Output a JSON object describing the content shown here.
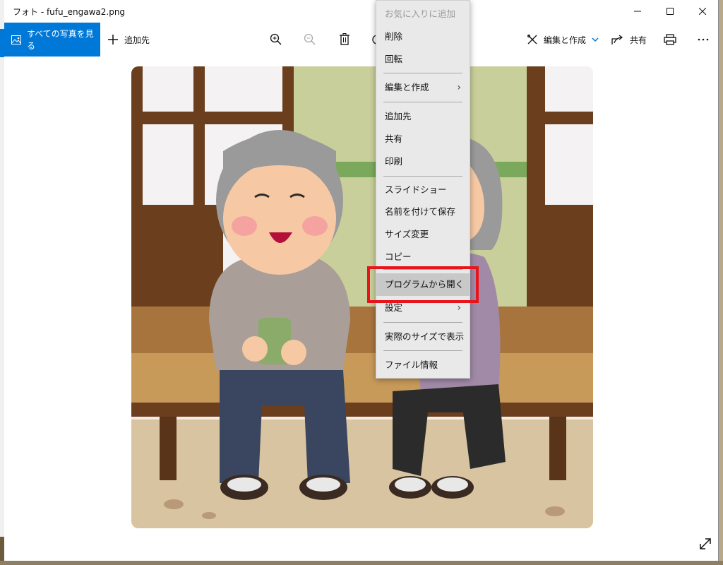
{
  "window": {
    "title": "フォト - fufu_engawa2.png",
    "buttons": [
      "minimize",
      "maximize",
      "close"
    ]
  },
  "toolbar": {
    "all_photos_label": "すべての写真を見る",
    "left_partial_glyph": "す",
    "add_to_label": "追加先",
    "edit_create_label": "編集と作成",
    "share_label": "共有",
    "icons": [
      "zoom-in-icon",
      "zoom-out-icon",
      "delete-icon",
      "rotate-icon",
      "edit-icon",
      "share-icon",
      "print-icon",
      "more-icon"
    ]
  },
  "context_menu": {
    "items": [
      {
        "label": "お気に入りに追加",
        "disabled": true
      },
      {
        "label": "削除"
      },
      {
        "label": "回転"
      },
      {
        "label": "編集と作成",
        "submenu": true
      },
      {
        "label": "追加先"
      },
      {
        "label": "共有"
      },
      {
        "label": "印刷"
      },
      {
        "label": "スライドショー"
      },
      {
        "label": "名前を付けて保存"
      },
      {
        "label": "サイズ変更"
      },
      {
        "label": "コピー"
      },
      {
        "label": "プログラムから開く",
        "highlighted": true
      },
      {
        "label": "設定",
        "submenu": true
      },
      {
        "label": "実際のサイズで表示"
      },
      {
        "label": "ファイル情報"
      }
    ],
    "chevron": "›"
  },
  "colors": {
    "accent": "#0078d7",
    "highlight_box": "#e8141c",
    "menu_bg": "#e9e9e9"
  }
}
